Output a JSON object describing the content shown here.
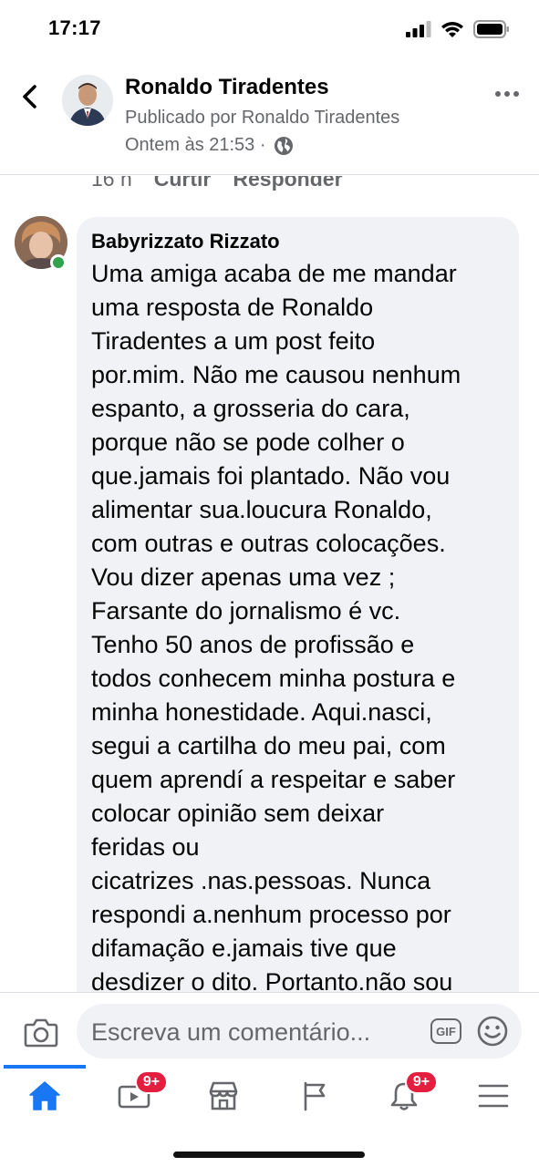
{
  "status_bar": {
    "time": "17:17"
  },
  "header": {
    "name": "Ronaldo Tiradentes",
    "subtitle": "Publicado por Ronaldo Tiradentes",
    "timestamp": "Ontem às 21:53 ·"
  },
  "previous_comment": {
    "time": "16 h",
    "like_label": "Curtir",
    "reply_label": "Responder"
  },
  "comment": {
    "author": "Babyrizzato Rizzato",
    "online": true,
    "text": "Uma amiga acaba de me mandar\numa resposta de Ronaldo\nTiradentes a um post feito\npor.mim. Não me causou nenhum\nespanto, a grosseria do cara,\nporque não se pode colher o\nque.jamais foi plantado. Não vou\nalimentar sua.loucura Ronaldo,\ncom outras e outras colocações.\nVou dizer apenas uma vez ;\nFarsante do jornalismo é vc.\nTenho 50 anos de profissão e\ntodos conhecem minha postura e\nminha honestidade. Aqui.nasci,\nsegui a cartilha do meu pai, com\nquem aprendí a respeitar e saber\ncolocar opinião sem deixar\nferidas ou\ncicatrizes .nas.pessoas. Nunca\nrespondi a.nenhum processo por\ndifamação e.jamais tive que\ndesdizer o dito. Portanto.não sou"
  },
  "composer": {
    "placeholder": "Escreva um comentário...",
    "gif_label": "GIF"
  },
  "tabbar": {
    "active": "home",
    "watch_badge": "9+",
    "notifications_badge": "9+"
  },
  "colors": {
    "accent": "#1877f2",
    "badge": "#e41e3f",
    "online": "#31a24c",
    "bubble": "#f0f2f5",
    "secondary_text": "#65676b"
  }
}
